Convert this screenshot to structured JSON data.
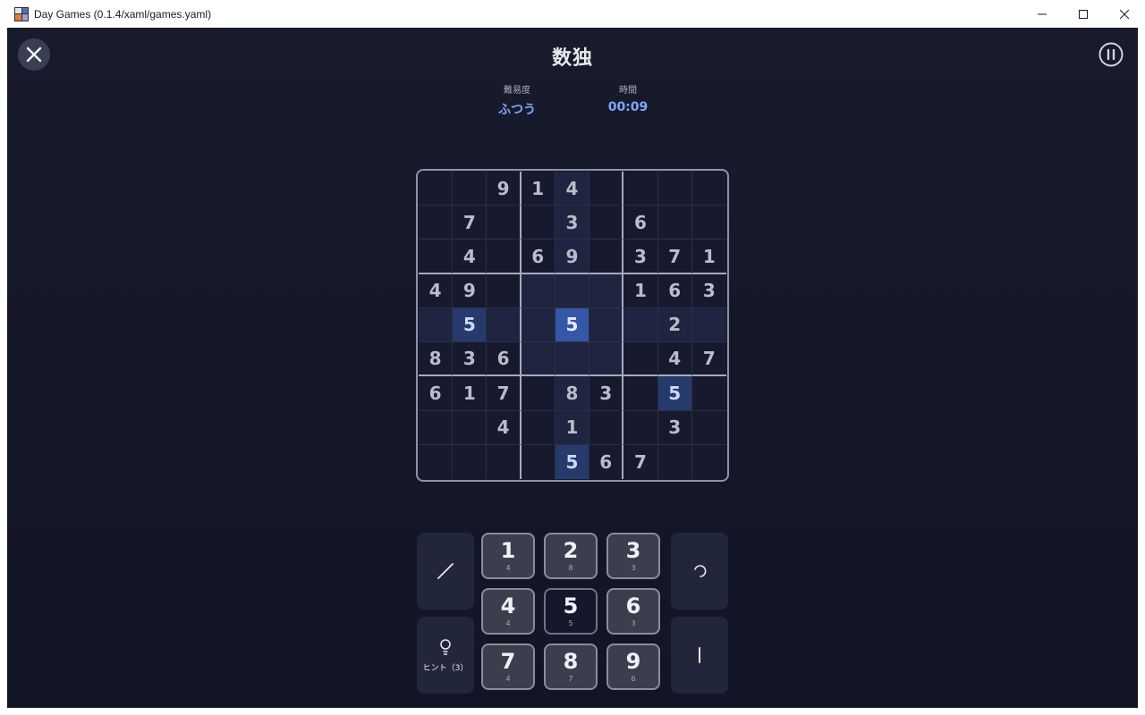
{
  "window": {
    "title": "Day Games (0.1.4/xaml/games.yaml)"
  },
  "header": {
    "title": "数独",
    "difficulty_label": "難易度",
    "difficulty_value": "ふつう",
    "time_label": "時間",
    "time_value": "00:09"
  },
  "board": {
    "rows": [
      [
        "",
        "",
        "9",
        "1",
        "4",
        "",
        "",
        "",
        ""
      ],
      [
        "",
        "7",
        "",
        "",
        "3",
        "",
        "6",
        "",
        ""
      ],
      [
        "",
        "4",
        "",
        "6",
        "9",
        "",
        "3",
        "7",
        "1"
      ],
      [
        "4",
        "9",
        "",
        "",
        "",
        "",
        "1",
        "6",
        "3"
      ],
      [
        "",
        "5",
        "",
        "",
        "5",
        "",
        "",
        "2",
        ""
      ],
      [
        "8",
        "3",
        "6",
        "",
        "",
        "",
        "",
        "4",
        "7"
      ],
      [
        "6",
        "1",
        "7",
        "",
        "8",
        "3",
        "",
        "5",
        ""
      ],
      [
        "",
        "",
        "4",
        "",
        "1",
        "",
        "",
        "3",
        ""
      ],
      [
        "",
        "",
        "",
        "",
        "5",
        "6",
        "7",
        "",
        ""
      ]
    ],
    "selected_cell": {
      "row": 4,
      "col": 4
    },
    "highlight_digit": "5"
  },
  "keypad": {
    "keys": [
      {
        "digit": "1",
        "count": "4"
      },
      {
        "digit": "2",
        "count": "8"
      },
      {
        "digit": "3",
        "count": "3"
      },
      {
        "digit": "4",
        "count": "4"
      },
      {
        "digit": "5",
        "count": "5"
      },
      {
        "digit": "6",
        "count": "3"
      },
      {
        "digit": "7",
        "count": "4"
      },
      {
        "digit": "8",
        "count": "7"
      },
      {
        "digit": "9",
        "count": "6"
      }
    ],
    "active_digit": "5",
    "hint_label": "ヒント（3）"
  },
  "icons": {
    "close": "close-icon",
    "pause": "pause-icon",
    "pencil": "pencil-icon",
    "hint": "lightbulb-icon",
    "undo": "undo-icon",
    "erase": "eraser-icon"
  },
  "colors": {
    "background": "#151829",
    "accent": "#7fa6ff",
    "selected_cell": "#3457a8",
    "same_digit_cell": "#263a6c"
  }
}
